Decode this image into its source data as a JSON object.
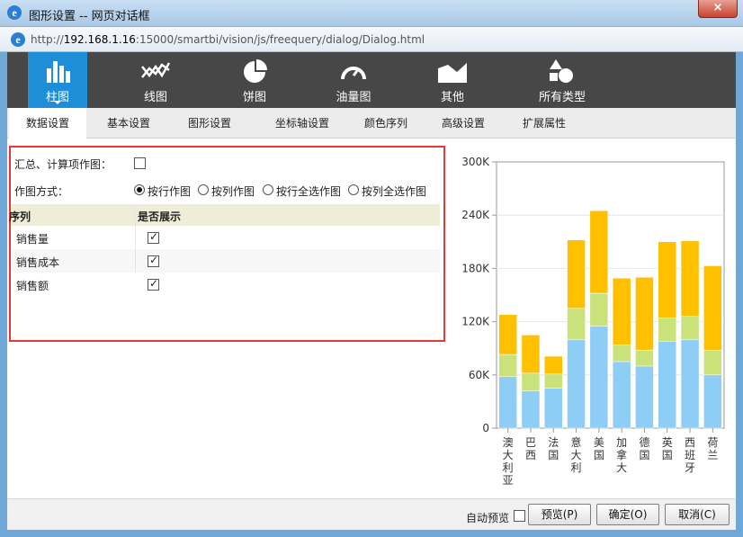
{
  "window": {
    "title": "图形设置 -- 网页对话框",
    "close_symbol": "×",
    "ie_letter": "e",
    "url_prefix": "http://",
    "url_host": "192.168.1.16",
    "url_rest": ":15000/smartbi/vision/js/freequery/dialog/Dialog.html"
  },
  "chart_types": [
    {
      "label": "柱图",
      "icon": "bar-chart-icon",
      "active": true
    },
    {
      "label": "线图",
      "icon": "line-chart-icon",
      "active": false
    },
    {
      "label": "饼图",
      "icon": "pie-chart-icon",
      "active": false
    },
    {
      "label": "油量图",
      "icon": "gauge-icon",
      "active": false
    },
    {
      "label": "其他",
      "icon": "area-chart-icon",
      "active": false
    },
    {
      "label": "所有类型",
      "icon": "shapes-icon",
      "active": false
    }
  ],
  "tabs": [
    {
      "label": "数据设置",
      "active": true
    },
    {
      "label": "基本设置",
      "active": false
    },
    {
      "label": "图形设置",
      "active": false
    },
    {
      "label": "坐标轴设置",
      "active": false
    },
    {
      "label": "颜色序列",
      "active": false
    },
    {
      "label": "高级设置",
      "active": false
    },
    {
      "label": "扩展属性",
      "active": false
    }
  ],
  "settings": {
    "summary_label": "汇总、计算项作图：",
    "summary_checked": false,
    "mode_label": "作图方式：",
    "modes": [
      {
        "label": "按行作图",
        "checked": true
      },
      {
        "label": "按列作图",
        "checked": false
      },
      {
        "label": "按行全选作图",
        "checked": false
      },
      {
        "label": "按列全选作图",
        "checked": false
      }
    ],
    "table": {
      "headers": [
        "序列",
        "是否展示"
      ],
      "rows": [
        {
          "name": "销售量",
          "checked": true
        },
        {
          "name": "销售成本",
          "checked": true
        },
        {
          "name": "销售额",
          "checked": true
        }
      ]
    }
  },
  "chart_data": {
    "type": "bar",
    "stacked": true,
    "categories": [
      "澳大利亚",
      "巴西",
      "法国",
      "意大利",
      "美国",
      "加拿大",
      "德国",
      "英国",
      "西班牙",
      "荷兰"
    ],
    "series": [
      {
        "color": "#8ecdf5",
        "values": [
          58000,
          42000,
          45000,
          100000,
          115000,
          75000,
          70000,
          98000,
          100000,
          60000
        ]
      },
      {
        "color": "#c9e27a",
        "values": [
          25000,
          20000,
          16000,
          35000,
          37000,
          19000,
          18000,
          26000,
          26000,
          28000
        ]
      },
      {
        "color": "#ffc000",
        "values": [
          45000,
          43000,
          20000,
          77000,
          93000,
          75000,
          82000,
          86000,
          85000,
          95000
        ]
      }
    ],
    "y_ticks": [
      "0",
      "60K",
      "120K",
      "180K",
      "240K",
      "300K"
    ],
    "ylim": [
      0,
      300000
    ],
    "grid": true
  },
  "footer": {
    "auto_preview_label": "自动预览",
    "auto_preview_checked": false,
    "preview": "预览(P)",
    "ok": "确定(O)",
    "cancel": "取消(C)"
  }
}
